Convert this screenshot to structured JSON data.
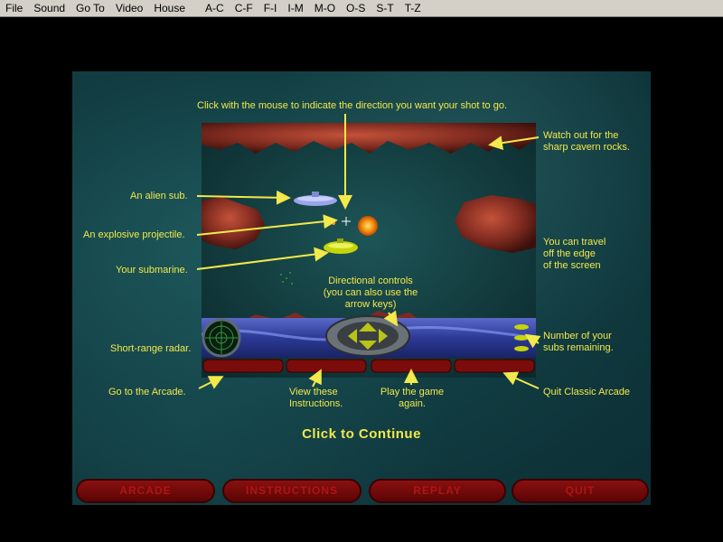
{
  "menu": [
    "File",
    "Sound",
    "Go To",
    "Video",
    "House",
    "A-C",
    "C-F",
    "F-I",
    "I-M",
    "M-O",
    "O-S",
    "S-T",
    "T-Z"
  ],
  "labels": {
    "click_direction": "Click with the mouse to indicate the direction you want your shot to go.",
    "cavern_rocks": [
      "Watch out for the",
      "sharp cavern rocks."
    ],
    "alien_sub": "An alien sub.",
    "projectile": "An explosive projectile.",
    "your_sub": "Your submarine.",
    "travel_edge": [
      "You can travel",
      "off the edge",
      "of the screen"
    ],
    "directional": [
      "Directional controls",
      "(you can also use the",
      "arrow keys)"
    ],
    "radar": "Short-range radar.",
    "subs_remaining": [
      "Number of your",
      "subs remaining."
    ],
    "go_arcade": "Go to the Arcade.",
    "view_instructions": [
      "View these",
      "Instructions."
    ],
    "play_again": [
      "Play the game",
      "again."
    ],
    "quit": "Quit Classic Arcade"
  },
  "continue_label": "Click to Continue",
  "buttons": {
    "arcade": "ARCADE",
    "instructions": "INSTRUCTIONS",
    "replay": "REPLAY",
    "quit": "QUIT"
  },
  "colors": {
    "label": "#f2e94a",
    "button": "#8a1010",
    "stage": "#123f44"
  }
}
